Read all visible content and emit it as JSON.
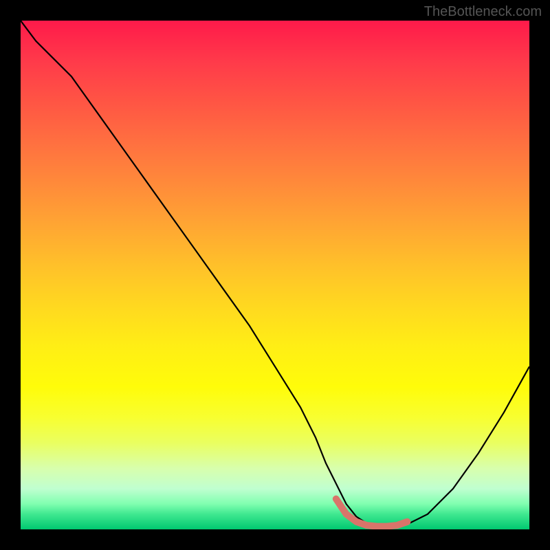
{
  "watermark": "TheBottleneck.com",
  "chart_data": {
    "type": "line",
    "title": "",
    "xlabel": "",
    "ylabel": "",
    "xlim": [
      0,
      100
    ],
    "ylim": [
      0,
      100
    ],
    "gradient": {
      "top_color": "#ff1a4a",
      "mid_color": "#ffee15",
      "bottom_color": "#00c870"
    },
    "series": [
      {
        "name": "bottleneck-curve",
        "color": "#000000",
        "x": [
          0,
          3,
          6,
          10,
          15,
          20,
          25,
          30,
          35,
          40,
          45,
          50,
          55,
          58,
          60,
          62,
          64,
          66,
          68,
          70,
          72,
          74,
          76,
          80,
          85,
          90,
          95,
          100
        ],
        "y": [
          100,
          96,
          93,
          89,
          82,
          75,
          68,
          61,
          54,
          47,
          40,
          32,
          24,
          18,
          13,
          9,
          5,
          2.5,
          1.2,
          0.7,
          0.6,
          0.7,
          1.0,
          3,
          8,
          15,
          23,
          32
        ]
      },
      {
        "name": "optimal-range-highlight",
        "color": "#d9746a",
        "x": [
          62,
          64,
          66,
          68,
          70,
          72,
          74,
          76
        ],
        "y": [
          6,
          3,
          1.5,
          0.8,
          0.6,
          0.6,
          0.8,
          1.5
        ]
      }
    ]
  }
}
